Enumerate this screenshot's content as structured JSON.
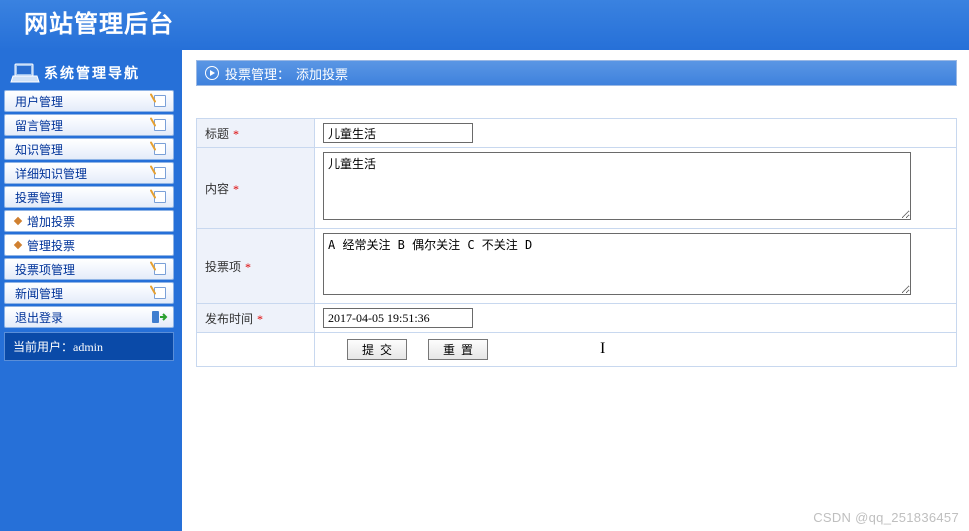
{
  "header": {
    "title": "网站管理后台"
  },
  "sidebar": {
    "nav_title": "系统管理导航",
    "items": [
      {
        "label": "用户管理"
      },
      {
        "label": "留言管理"
      },
      {
        "label": "知识管理"
      },
      {
        "label": "详细知识管理"
      },
      {
        "label": "投票管理"
      },
      {
        "label": "增加投票"
      },
      {
        "label": "管理投票"
      },
      {
        "label": "投票项管理"
      },
      {
        "label": "新闻管理"
      },
      {
        "label": "退出登录"
      }
    ],
    "current_user_label": "当前用户：",
    "current_user_value": "admin"
  },
  "panel": {
    "breadcrumb_module": "投票管理：",
    "breadcrumb_action": "添加投票"
  },
  "form": {
    "title_label": "标题",
    "title_value": "儿童生活",
    "content_label": "内容",
    "content_value": "儿童生活",
    "options_label": "投票项",
    "options_value": "A 经常关注 B 偶尔关注 C 不关注 D",
    "publish_label": "发布时间",
    "publish_value": "2017-04-05 19:51:36",
    "submit_label": "提交",
    "reset_label": "重置"
  },
  "watermark": "CSDN @qq_251836457"
}
